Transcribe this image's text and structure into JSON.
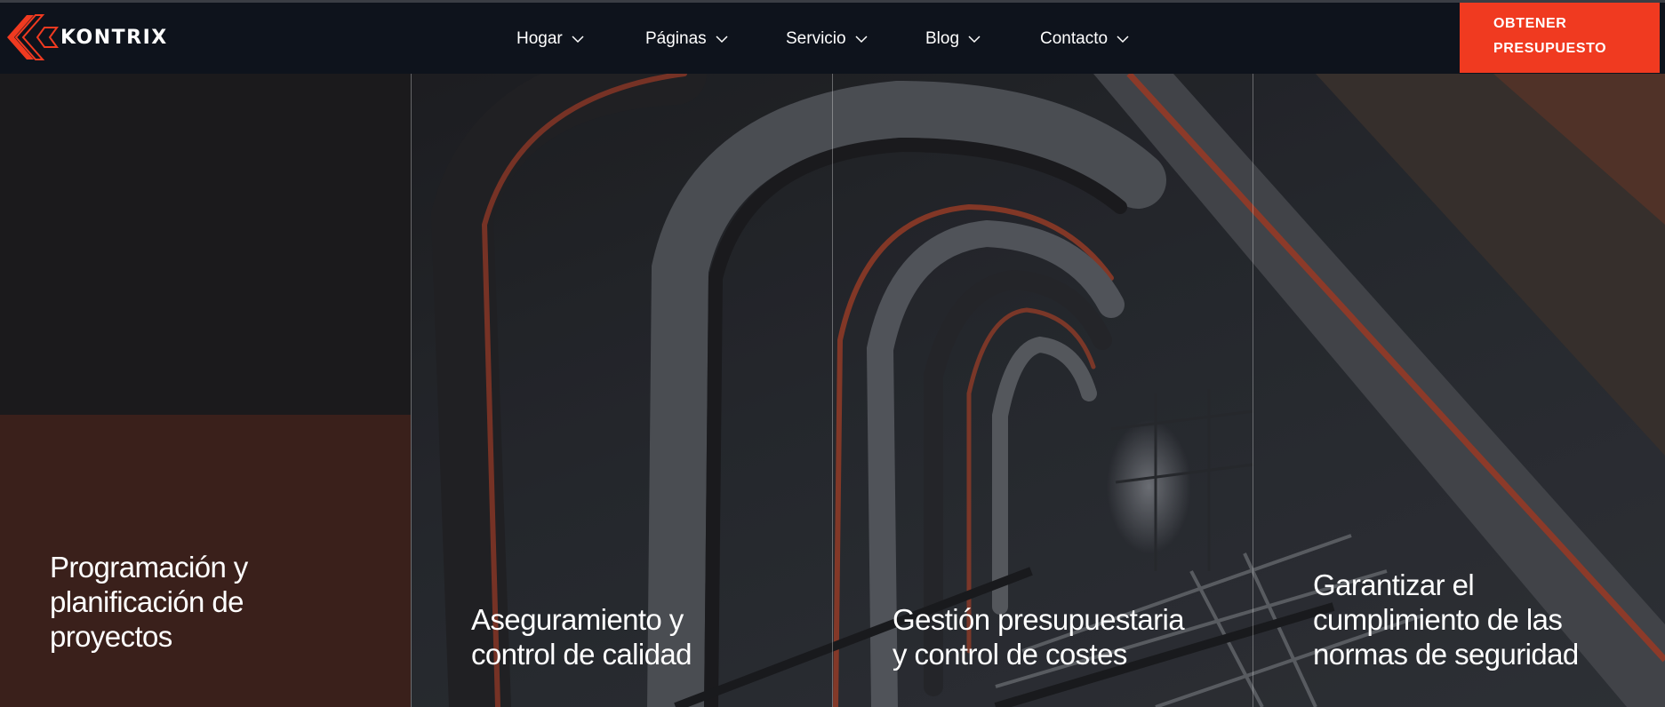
{
  "brand": {
    "name": "KONTRIX",
    "accent": "#f03a20"
  },
  "nav": {
    "items": [
      {
        "label": "Hogar"
      },
      {
        "label": "Páginas"
      },
      {
        "label": "Servicio"
      },
      {
        "label": "Blog"
      },
      {
        "label": "Contacto"
      }
    ]
  },
  "cta": {
    "line1": "OBTENER",
    "line2": "PRESUPUESTO",
    "color": "#f03a20"
  },
  "services": [
    {
      "title_lines": [
        "Programación y",
        "planificación de",
        "proyectos"
      ]
    },
    {
      "title_lines": [
        "Aseguramiento y",
        "control de calidad"
      ]
    },
    {
      "title_lines": [
        "Gestión presupuestaria",
        "y control de costes"
      ]
    },
    {
      "title_lines": [
        "Garantizar el",
        "cumplimiento de las",
        "normas de seguridad"
      ]
    }
  ],
  "icons": {
    "logo": "kontrix-chevron-logo",
    "dropdown": "chevron-down-icon"
  }
}
